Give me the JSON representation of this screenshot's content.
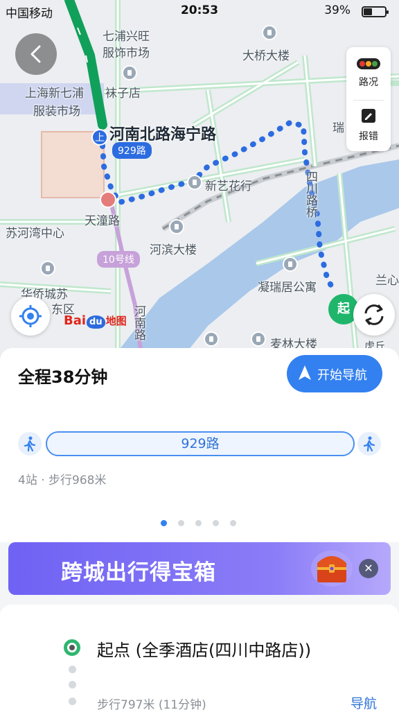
{
  "status_bar": {
    "carrier": "中国移动",
    "time": "20:53",
    "battery": "39%",
    "battery_level": 0.39
  },
  "map": {
    "labels": {
      "market_top": "七浦兴旺",
      "market_top2": "服饰市场",
      "daqiao": "大桥大楼",
      "shanghai_a": "上海新七浦",
      "shanghai_b": "服装市场",
      "sock": "袜子店",
      "road_main": "河南北路海宁路",
      "bus_tag": "929路",
      "xinyi": "新艺花行",
      "tiantong": "天潼路",
      "suhe": "苏河湾中心",
      "hebin": "河滨大楼",
      "line10": "10号线",
      "ningrui": "凝瑞居公寓",
      "huaqiao_a": "华侨城苏",
      "huaqiao_b": "东区",
      "sichuan_bridge": "四川路桥",
      "henan_road": "河南路",
      "mailin": "麦林大楼",
      "rui": "瑞",
      "lan": "兰心",
      "hu": "虎丘",
      "start_marker": "起",
      "up_marker": "上"
    },
    "side_panel": {
      "traffic": "路况",
      "report": "报错"
    },
    "logo": {
      "bai": "Bai",
      "du": "du",
      "map_word": "地图"
    }
  },
  "route_sheet": {
    "summary": "全程38分钟",
    "start_nav": "开始导航",
    "bus_line": "929路",
    "info": "4站 · 步行968米",
    "page_count": 5,
    "active_page": 0
  },
  "banner": {
    "title": "跨城出行得宝箱",
    "close": "✕"
  },
  "steps": {
    "start_label": "起点 (全季酒店(四川中路店))",
    "walk_label": "步行797米 (11分钟)",
    "nav_link": "导航"
  },
  "colors": {
    "accent": "#3380f0",
    "route_green": "#1fb66b",
    "banner_purple": "#7265f5",
    "traffic_red": "#e53935",
    "traffic_yellow": "#f9a825",
    "traffic_green": "#43a047"
  },
  "icons": {
    "back": "chevron-left-icon",
    "traffic": "traffic-light-icon",
    "report": "edit-icon",
    "locate": "locate-icon",
    "refresh": "refresh-icon",
    "walk": "walk-icon",
    "navigate": "navigate-arrow-icon",
    "chest": "treasure-chest-icon"
  }
}
